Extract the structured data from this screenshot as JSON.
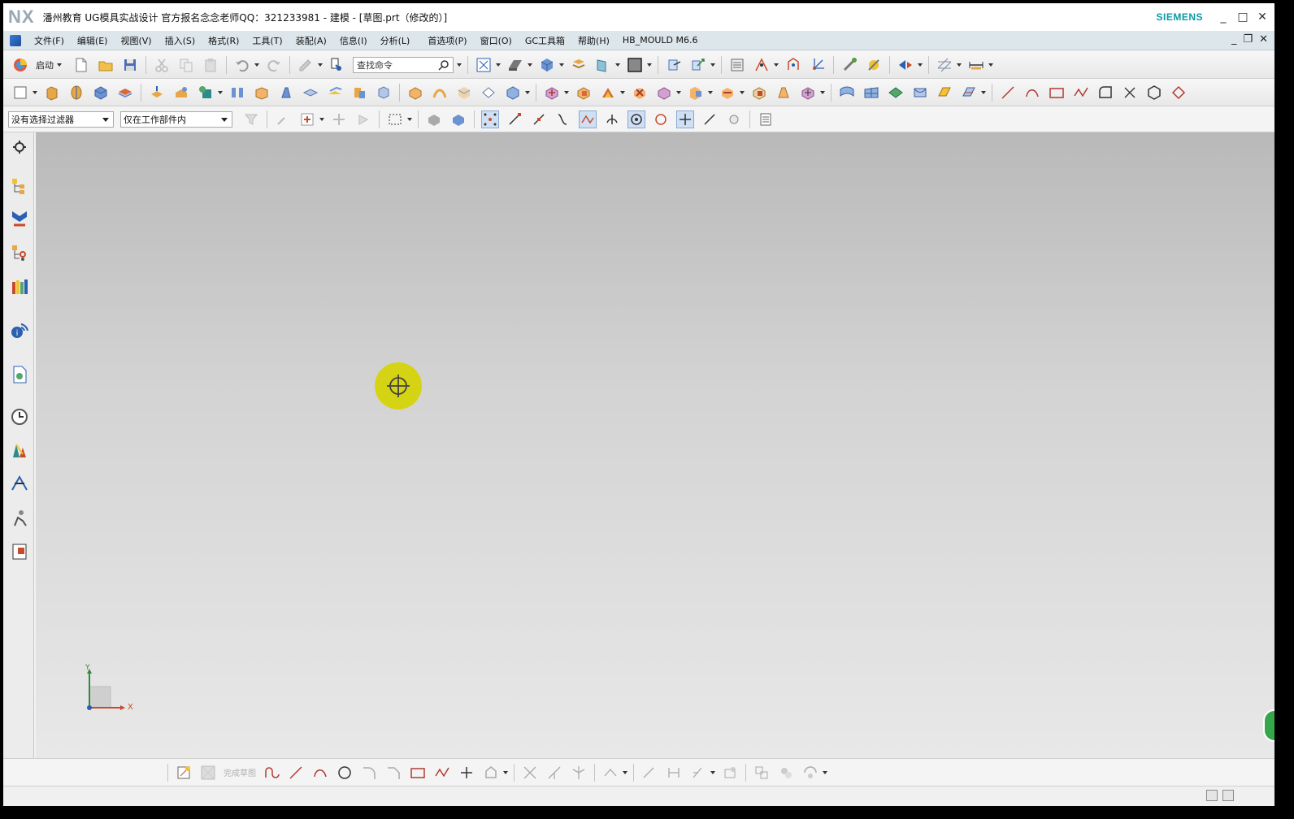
{
  "titlebar": {
    "logo": "NX",
    "title": "潘州教育 UG模具实战设计  官方报名念念老师QQ：321233981 - 建模 - [草图.prt（修改的）]",
    "brand": "SIEMENS",
    "controls": [
      "_",
      "□",
      "✕"
    ]
  },
  "menubar": {
    "items": [
      "文件(F)",
      "编辑(E)",
      "视图(V)",
      "插入(S)",
      "格式(R)",
      "工具(T)",
      "装配(A)",
      "信息(I)",
      "分析(L)",
      "首选项(P)",
      "窗口(O)",
      "GC工具箱",
      "帮助(H)",
      "HB_MOULD M6.6"
    ],
    "sub_controls": [
      "_",
      "❐",
      "✕"
    ]
  },
  "toolbar": {
    "start_label": "启动",
    "command_search_placeholder": "查找命令"
  },
  "selection_bar": {
    "type_filter": "没有选择过滤器",
    "scope": "仅在工作部件内"
  },
  "sketch_toolbar": {
    "faded_label": "完成草图"
  },
  "triad": {
    "x_label": "X",
    "y_label": "Y"
  },
  "colors": {
    "menubar_bg": "#dde6ea",
    "brand": "#0a9aa3",
    "cursor_marker": "#d6d400",
    "graphics_top": "#b9b9b9",
    "graphics_bottom": "#e8e8e8"
  }
}
